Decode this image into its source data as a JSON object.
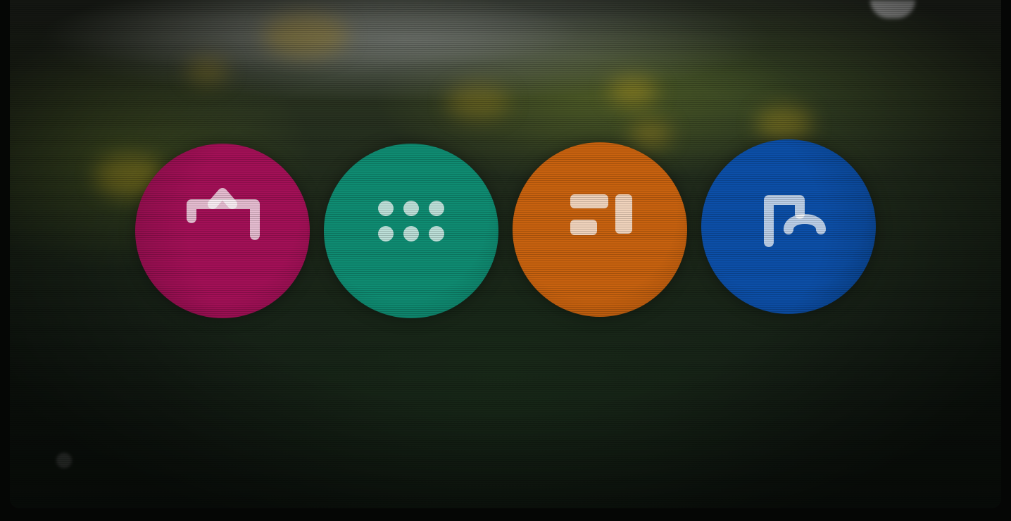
{
  "theme": {
    "background": "#050605",
    "tile_text": "#ffffff"
  },
  "tiles": [
    {
      "label": "",
      "icon": "tv-icon",
      "color": "#a31057"
    },
    {
      "label": "",
      "icon": "apps-grid-icon",
      "color": "#0f8c72"
    },
    {
      "label": "",
      "icon": "media-list-icon",
      "color": "#c8620f"
    },
    {
      "label": "",
      "icon": "home-icon",
      "color": "#0c4fa8"
    }
  ]
}
